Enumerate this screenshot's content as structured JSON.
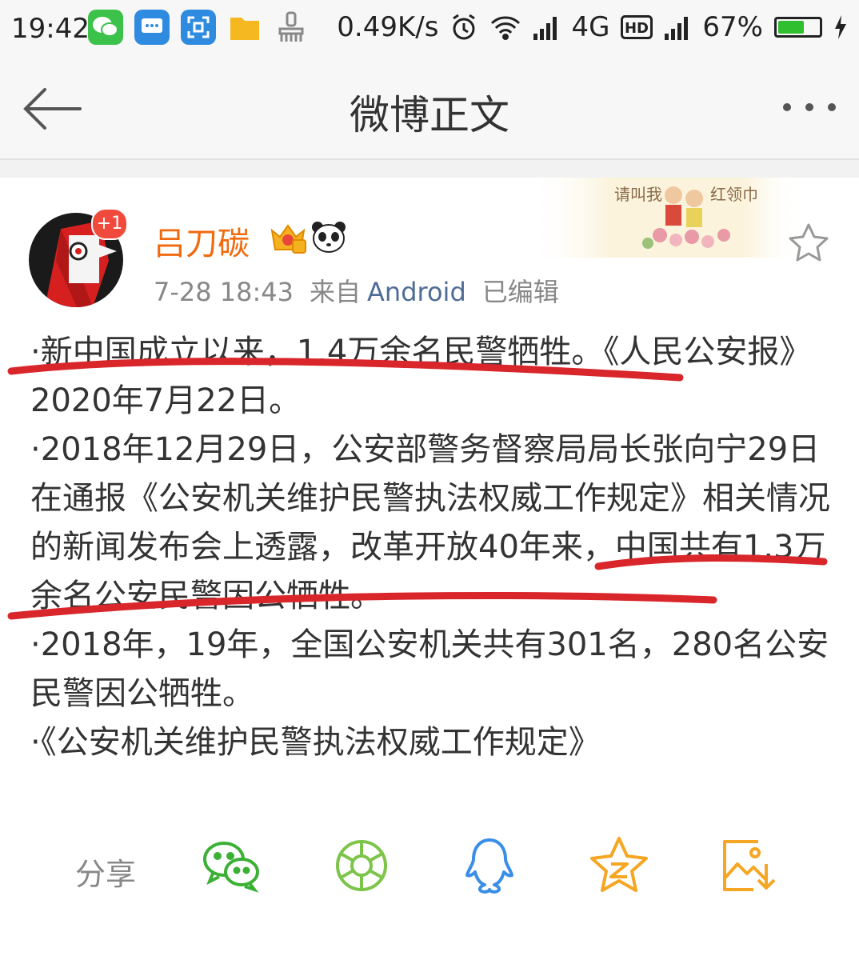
{
  "status_bar": {
    "time": "19:42",
    "speed": "0.49K/s",
    "network": "4G",
    "battery": "67%",
    "battery_level": 0.67,
    "app_icons": [
      "wechat-icon",
      "message-icon",
      "scan-icon",
      "folder-icon",
      "brush-icon"
    ]
  },
  "nav": {
    "title": "微博正文"
  },
  "banner": {
    "left_text": "请叫我",
    "right_text": "红领巾"
  },
  "post": {
    "author": "吕刀碳",
    "badge_count": "+1",
    "date": "7-28 18:43",
    "source_prefix": "来自",
    "source": "Android",
    "edited": "已编辑",
    "paragraphs": [
      "·新中国成立以来，1.4万余名民警牺牲。《人民公安报》2020年7月22日。",
      "·2018年12月29日，公安部警务督察局局长张向宁29日在通报《公安机关维护民警执法权威工作规定》相关情况的新闻发布会上透露，改革开放40年来，中国共有1.3万余名公安民警因公牺牲。",
      "·2018年，19年，全国公安机关共有301名，280名公安民警因公牺牲。",
      "·《公安机关维护民警执法权威工作规定》"
    ]
  },
  "share": {
    "label": "分享",
    "targets": [
      "wechat-icon",
      "moments-icon",
      "qq-icon",
      "qzone-icon",
      "save-image-icon"
    ]
  },
  "colors": {
    "username": "#f06a0f",
    "source_link": "#506c96",
    "highlight_line": "#d9262b",
    "share_green": "#3cb034",
    "share_blue": "#3a8ee6",
    "share_orange": "#f5a623"
  }
}
